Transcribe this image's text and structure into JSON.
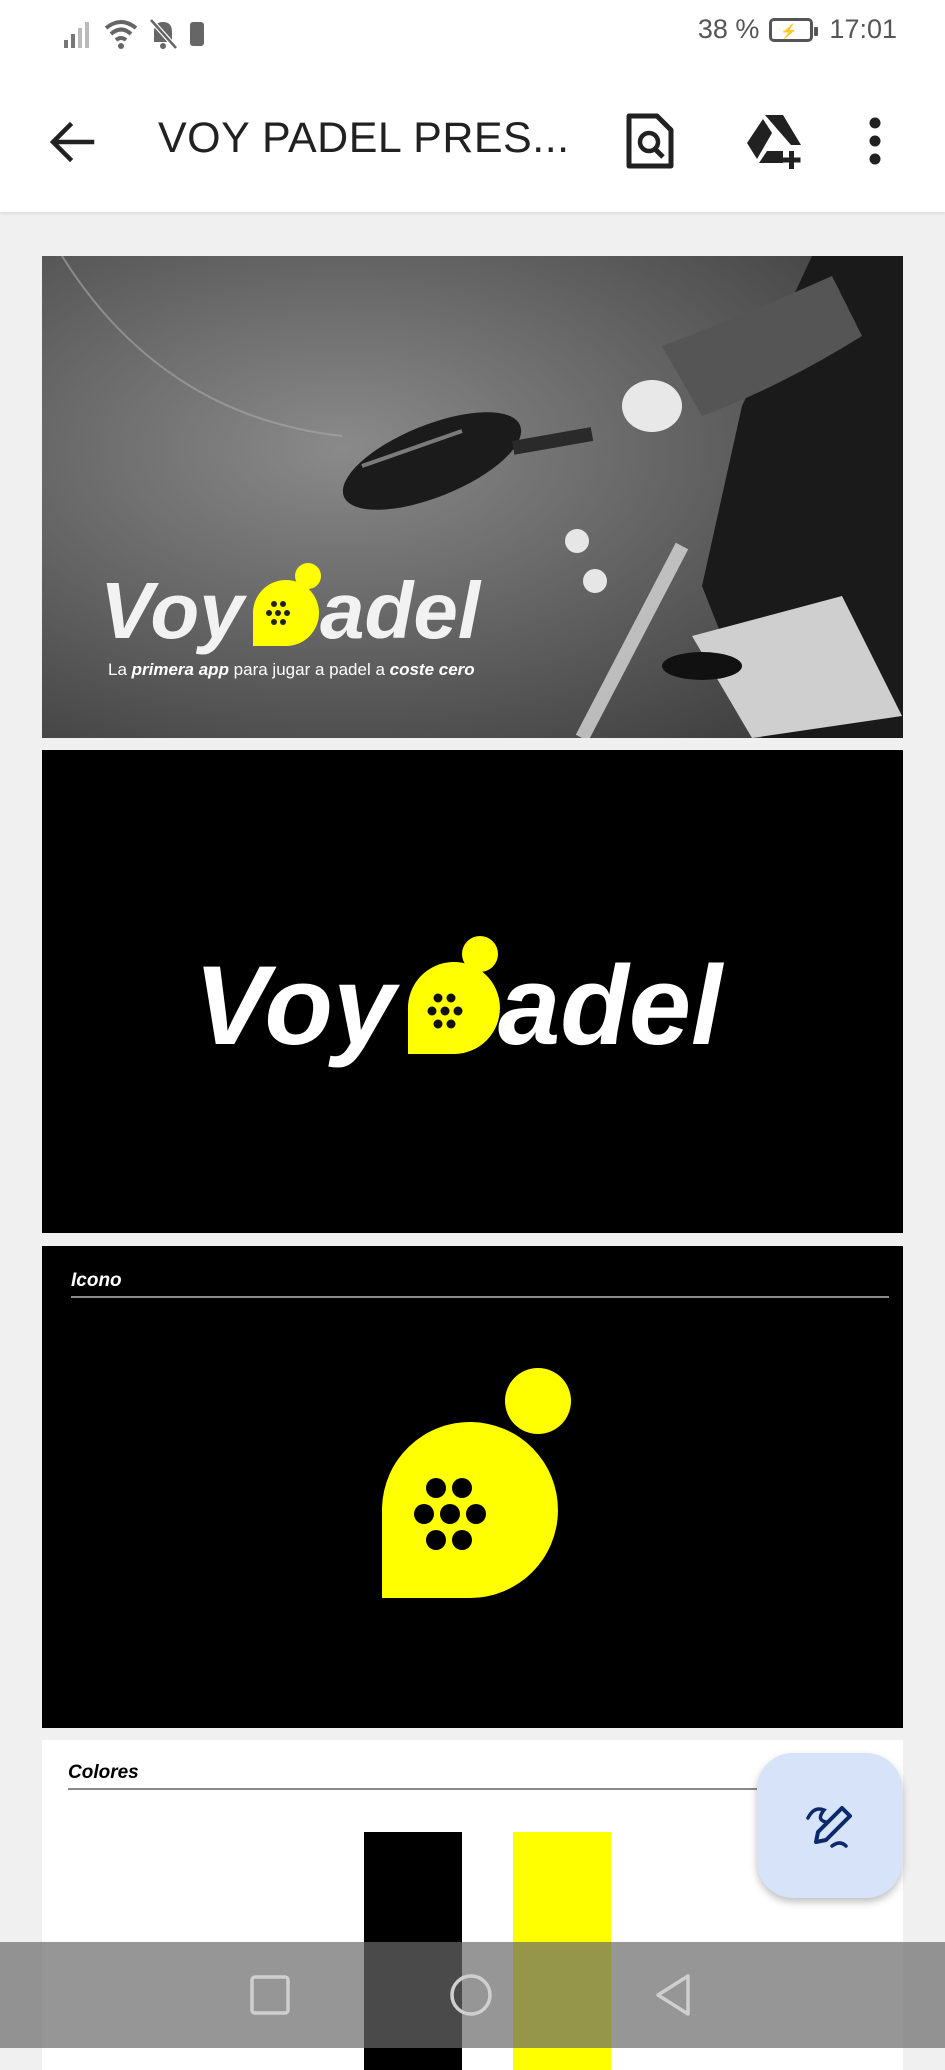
{
  "status_bar": {
    "battery_percent": "38 %",
    "time": "17:01",
    "icons": [
      "signal-icon",
      "wifi-icon",
      "bell-off-icon",
      "sd-card-icon",
      "battery-charging-icon"
    ]
  },
  "app_bar": {
    "title": "VOY PADEL PRES...",
    "actions": [
      "back-arrow-icon",
      "find-in-document-icon",
      "add-to-drive-icon",
      "more-vert-icon"
    ]
  },
  "pages": {
    "cover": {
      "logo_text": "Voypadel",
      "tagline_parts": [
        "La ",
        "primera app",
        " para jugar a padel a ",
        "coste cero"
      ]
    },
    "logo": {
      "logo_text": "Voypadel"
    },
    "icon": {
      "section_label": "Icono"
    },
    "colors": {
      "section_label": "Colores",
      "swatches": [
        "#000000",
        "#ffff00"
      ]
    }
  },
  "colors": {
    "brand_yellow": "#ffff00",
    "fab_bg": "#d7e3f8",
    "icon_blue": "#0b2a6b"
  },
  "nav_bar": {
    "buttons": [
      "recents-icon",
      "home-icon",
      "back-triangle-icon"
    ]
  },
  "fab": {
    "icon": "edit-pen-icon"
  }
}
